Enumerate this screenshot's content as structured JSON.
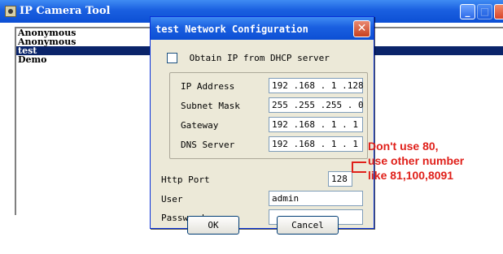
{
  "main_window": {
    "title": "IP Camera Tool",
    "cameras": [
      {
        "name": "Anonymous",
        "selected": false
      },
      {
        "name": "Anonymous",
        "selected": false
      },
      {
        "name": "test",
        "selected": true
      },
      {
        "name": "Demo",
        "selected": false
      }
    ]
  },
  "dialog": {
    "title": "test Network Configuration",
    "close_glyph": "✕",
    "dhcp": {
      "label": "Obtain IP from DHCP server",
      "checked": false
    },
    "fields": {
      "ip_address": {
        "label": "IP Address",
        "value": "192 .168 . 1  .128"
      },
      "subnet_mask": {
        "label": "Subnet Mask",
        "value": "255 .255 .255 . 0"
      },
      "gateway": {
        "label": "Gateway",
        "value": "192 .168 . 1  . 1"
      },
      "dns_server": {
        "label": "DNS Server",
        "value": "192 .168 . 1  . 1"
      },
      "http_port": {
        "label": "Http Port",
        "value": "128"
      },
      "user": {
        "label": "User",
        "value": "admin"
      },
      "password": {
        "label": "Password",
        "value": ""
      }
    },
    "buttons": {
      "ok": "OK",
      "cancel": "Cancel"
    }
  },
  "annotation": {
    "lines": [
      "Don't use 80,",
      "use other number",
      "like 81,100,8091"
    ],
    "color": "#e0201a"
  },
  "colors": {
    "titlebar": "#1a5fe0",
    "selection": "#0a246a",
    "dialog_bg": "#ece9d8"
  },
  "icons": {
    "app": "camera-app-icon",
    "minimize": "minimize-icon",
    "maximize": "maximize-icon",
    "close": "close-icon"
  }
}
